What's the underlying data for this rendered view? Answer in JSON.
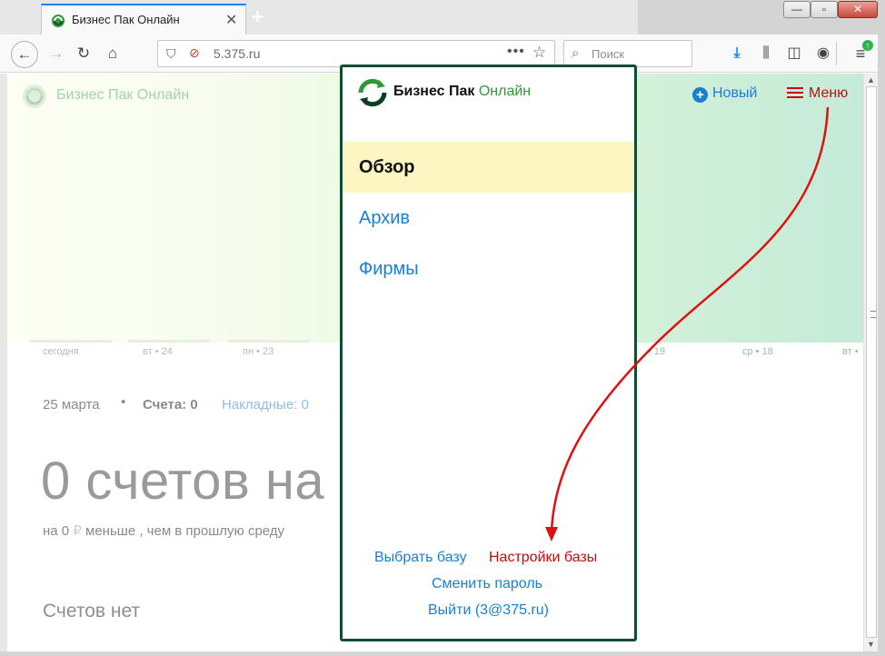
{
  "browser": {
    "tab_title": "Бизнес Пак Онлайн",
    "url": "5.375.ru",
    "search_placeholder": "Поиск"
  },
  "header": {
    "brand": "Бизнес Пак Онлайн",
    "new_label": "Новый",
    "menu_label": "Меню"
  },
  "timeline": {
    "days": [
      "сегодня",
      "вт • 24",
      "пн • 23",
      "• 19",
      "ср • 18",
      "вт •"
    ]
  },
  "summary": {
    "date": "25 марта",
    "separator": "•",
    "invoices_label": "Счета:",
    "invoices_count": "0",
    "waybills_label": "Накладные:",
    "waybills_count": "0",
    "headline": "0 счетов на",
    "subline_start": "на 0",
    "currency": "₽",
    "subline_end": "меньше , чем в прошлую среду",
    "empty": "Счетов нет"
  },
  "drawer": {
    "brand_bold": "Бизнес Пак",
    "brand_green": "Онлайн",
    "items": [
      {
        "label": "Обзор"
      },
      {
        "label": "Архив"
      },
      {
        "label": "Фирмы"
      }
    ],
    "footer": {
      "choose_base": "Выбрать базу",
      "base_settings": "Настройки базы",
      "change_password": "Сменить пароль",
      "logout": "Выйти (3@375.ru)"
    }
  },
  "colors": {
    "drawer_border": "#114d33",
    "accent_blue": "#1a7fd1",
    "accent_red": "#c40c0c",
    "active_bg": "#fdf6c3",
    "brand_green": "#2e9a37"
  }
}
